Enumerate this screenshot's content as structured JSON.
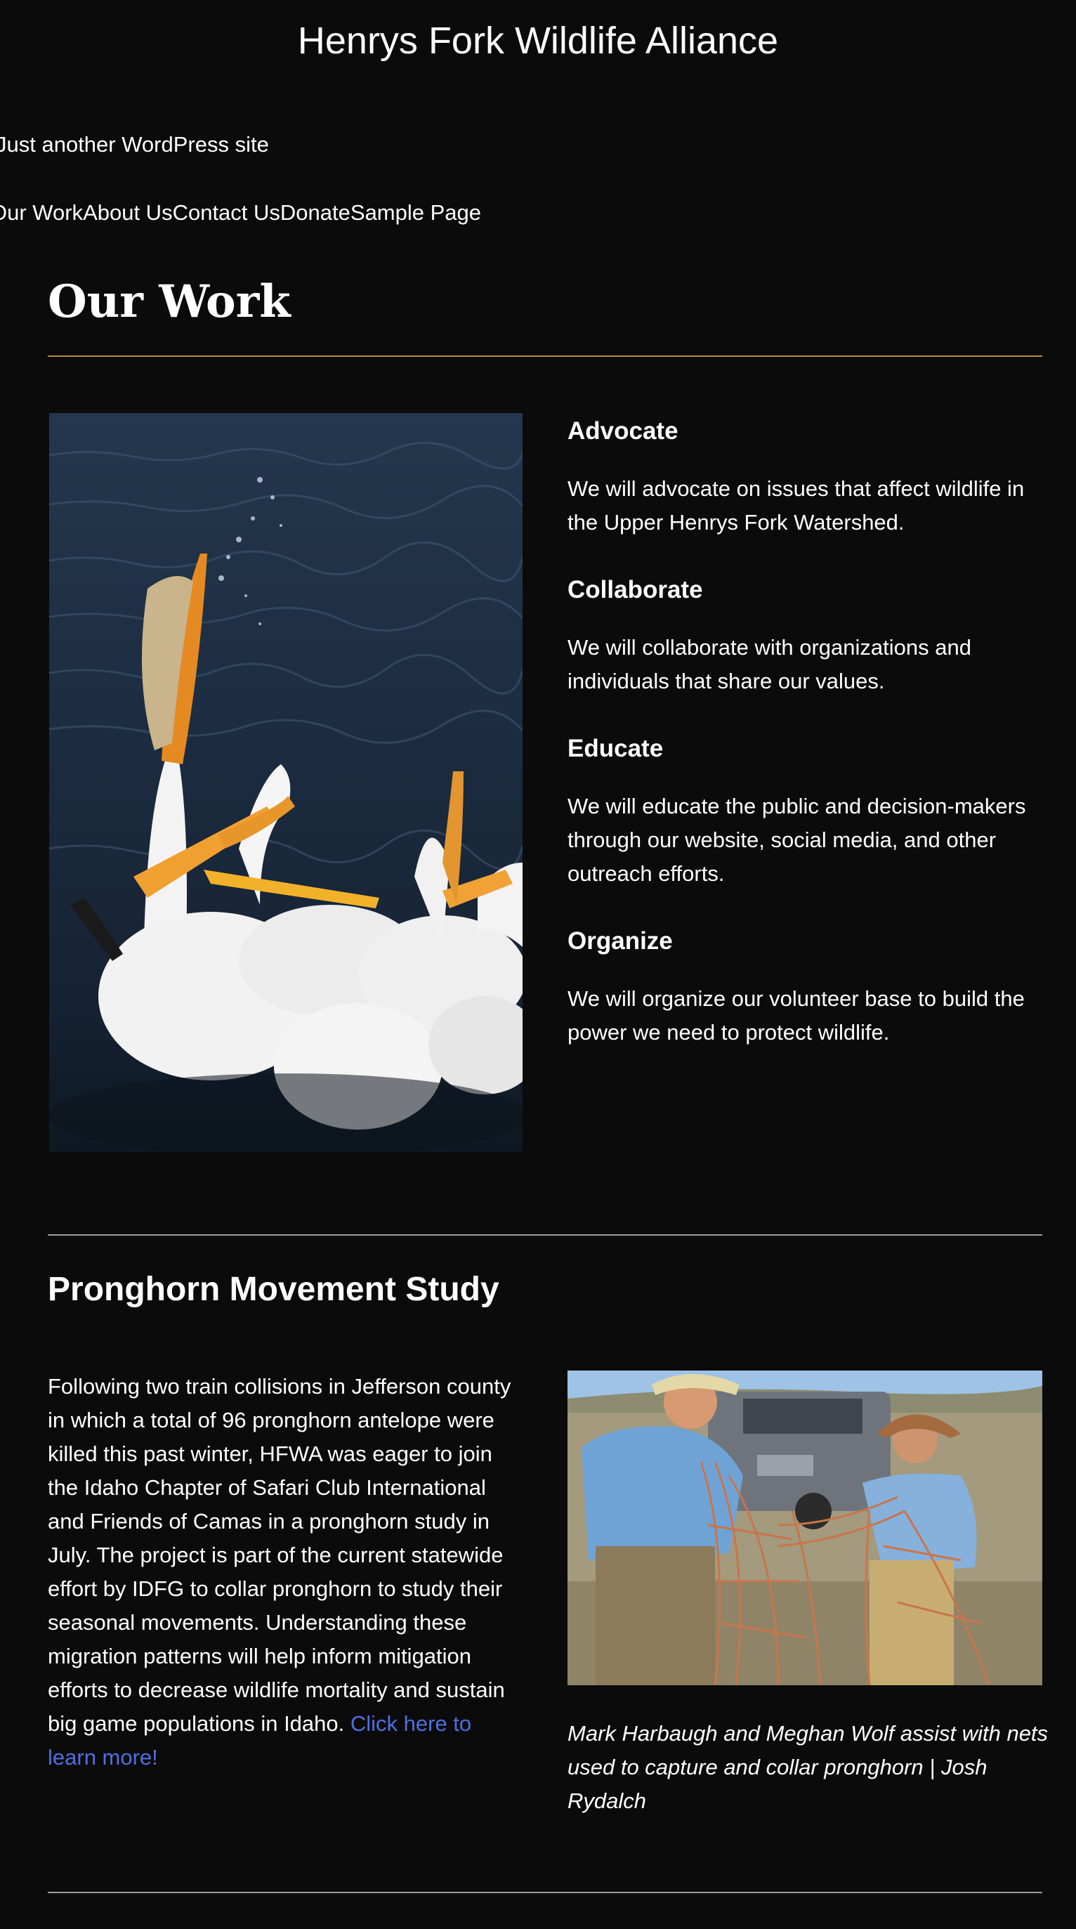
{
  "site": {
    "title": "Henrys Fork Wildlife Alliance",
    "tagline": "Just another WordPress site"
  },
  "nav": {
    "items": [
      {
        "label": "Our Work"
      },
      {
        "label": "About Us"
      },
      {
        "label": "Contact Us"
      },
      {
        "label": "Donate"
      },
      {
        "label": "Sample Page"
      }
    ]
  },
  "page": {
    "title": "Our Work"
  },
  "pillars": [
    {
      "heading": "Advocate",
      "text": "We will advocate on issues that affect wildlife in the Upper Henrys Fork Watershed."
    },
    {
      "heading": "Collaborate",
      "text": "We will collaborate with organizations and individuals that share our values."
    },
    {
      "heading": "Educate",
      "text": "We will educate the public and decision-makers through our website, social media, and other outreach efforts."
    },
    {
      "heading": "Organize",
      "text": "We will organize our volunteer base to build the power we need to protect wildlife."
    }
  ],
  "study": {
    "heading": "Pronghorn Movement Study",
    "body": "Following two train collisions in Jefferson county in which a total of 96 pronghorn antelope were killed this past winter, HFWA was eager to join the Idaho Chapter of Safari Club International and Friends of Camas in a pronghorn study in July. The project is part of the current statewide effort by IDFG to collar pronghorn to study their seasonal movements. Understanding these migration patterns will help inform mitigation efforts to decrease wildlife mortality and sustain big game populations in Idaho. ",
    "link_text": "Click here to learn more!",
    "caption": "Mark Harbaugh and Meghan Wolf assist with nets used to capture and collar pronghorn | Josh Rydalch"
  },
  "colors": {
    "background": "#0b0b0b",
    "accent_rule": "#b8893a",
    "link": "#4f6fe0"
  }
}
